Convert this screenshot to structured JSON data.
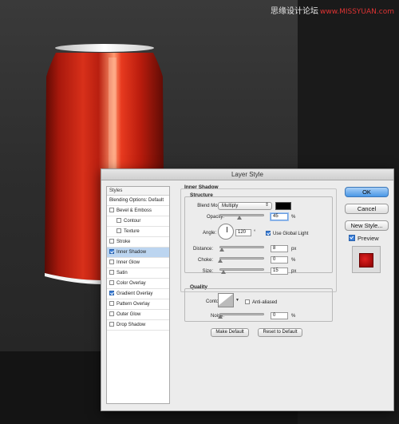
{
  "watermark": {
    "text": "思缘设计论坛",
    "url": "www.MISSYUAN.com"
  },
  "dialog": {
    "title": "Layer Style",
    "styles_panel": {
      "header": "Styles",
      "items": [
        {
          "label": "Blending Options: Default",
          "checkbox": false,
          "checked": false,
          "sub": false,
          "selected": false
        },
        {
          "label": "Bevel & Emboss",
          "checkbox": true,
          "checked": false,
          "sub": false,
          "selected": false
        },
        {
          "label": "Contour",
          "checkbox": true,
          "checked": false,
          "sub": true,
          "selected": false
        },
        {
          "label": "Texture",
          "checkbox": true,
          "checked": false,
          "sub": true,
          "selected": false
        },
        {
          "label": "Stroke",
          "checkbox": true,
          "checked": false,
          "sub": false,
          "selected": false
        },
        {
          "label": "Inner Shadow",
          "checkbox": true,
          "checked": true,
          "sub": false,
          "selected": true
        },
        {
          "label": "Inner Glow",
          "checkbox": true,
          "checked": false,
          "sub": false,
          "selected": false
        },
        {
          "label": "Satin",
          "checkbox": true,
          "checked": false,
          "sub": false,
          "selected": false
        },
        {
          "label": "Color Overlay",
          "checkbox": true,
          "checked": false,
          "sub": false,
          "selected": false
        },
        {
          "label": "Gradient Overlay",
          "checkbox": true,
          "checked": true,
          "sub": false,
          "selected": false
        },
        {
          "label": "Pattern Overlay",
          "checkbox": true,
          "checked": false,
          "sub": false,
          "selected": false
        },
        {
          "label": "Outer Glow",
          "checkbox": true,
          "checked": false,
          "sub": false,
          "selected": false
        },
        {
          "label": "Drop Shadow",
          "checkbox": true,
          "checked": false,
          "sub": false,
          "selected": false
        }
      ]
    },
    "inner_shadow": {
      "title": "Inner Shadow",
      "structure_title": "Structure",
      "blend_mode_label": "Blend Mode:",
      "blend_mode_value": "Multiply",
      "blend_color": "#000000",
      "opacity_label": "Opacity:",
      "opacity_value": "45",
      "opacity_unit": "%",
      "opacity_level": 45,
      "angle_label": "Angle:",
      "angle_value": "120",
      "angle_unit": "°",
      "global_light_label": "Use Global Light",
      "global_light_checked": true,
      "distance_label": "Distance:",
      "distance_value": "8",
      "distance_unit": "px",
      "choke_label": "Choke:",
      "choke_value": "0",
      "choke_unit": "%",
      "size_label": "Size:",
      "size_value": "15",
      "size_unit": "px",
      "quality_title": "Quality",
      "contour_label": "Contour:",
      "anti_aliased_label": "Anti-aliased",
      "anti_aliased_checked": false,
      "noise_label": "Noise:",
      "noise_value": "0",
      "noise_unit": "%",
      "make_default_label": "Make Default",
      "reset_default_label": "Reset to Default"
    },
    "buttons": {
      "ok": "OK",
      "cancel": "Cancel",
      "new_style": "New Style...",
      "preview_label": "Preview",
      "preview_checked": true
    }
  },
  "colors": {
    "can_red": "#c8220f",
    "selection": "#bcd5f0",
    "ok_button": "#4a97e6"
  }
}
